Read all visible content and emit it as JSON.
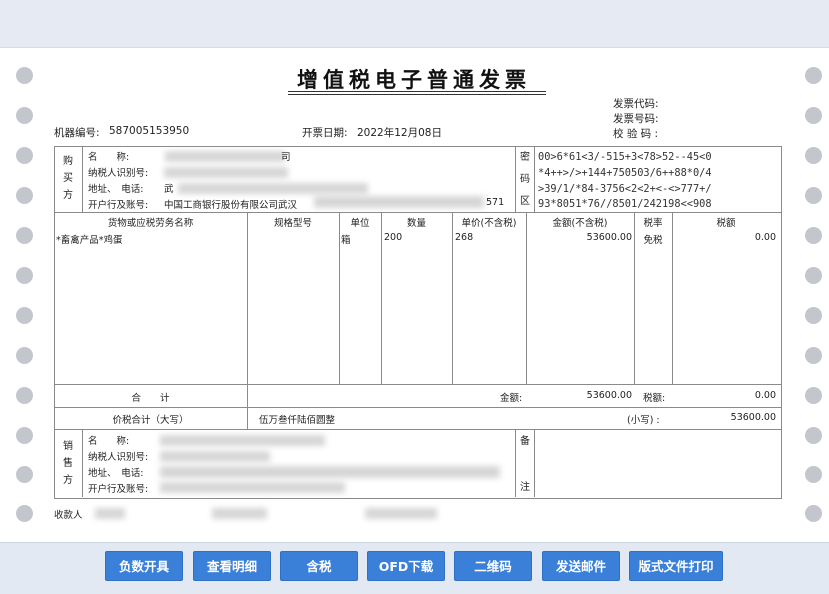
{
  "invoice": {
    "title": "增值税电子普通发票",
    "meta": {
      "code_label": "发票代码:",
      "number_label": "发票号码:",
      "check_label": "校 验 码 :",
      "machine_label": "机器编号:",
      "machine_no": "587005153950",
      "date_label": "开票日期:",
      "date": "2022年12月08日"
    },
    "buyer": {
      "section": [
        "购",
        "买",
        "方"
      ],
      "name_label": "名　　称:",
      "name_partial": "司",
      "taxid_label": "纳税人识别号:",
      "addr_label": "地址、　电话:",
      "addr_partial": "武",
      "bank_label": "开户行及账号:",
      "bank": "中国工商银行股份有限公司武汉",
      "bank_tail": "571"
    },
    "cipher": {
      "section": [
        "密",
        "码",
        "区"
      ],
      "lines": [
        "00>6*61<3/-515+3<78>52--45<0",
        "*4++>/>+144+750503/6++88*0/4",
        ">39/1/*84-3756<2<2+<-<>777+/",
        "93*8051*76//8501/242198<<908"
      ]
    },
    "items_header": {
      "name": "货物或应税劳务名称",
      "spec": "规格型号",
      "unit": "单位",
      "qty": "数量",
      "price": "单价(不含税)",
      "amount": "金额(不含税)",
      "rate": "税率",
      "tax": "税额"
    },
    "items": [
      {
        "name": "*畜禽产品*鸡蛋",
        "spec": "",
        "unit": "箱",
        "qty": "200",
        "price": "268",
        "amount": "53600.00",
        "rate": "免税",
        "tax": "0.00"
      }
    ],
    "totals": {
      "label": "合　　计",
      "amount_label": "金额:",
      "amount": "53600.00",
      "tax_label": "税额:",
      "tax": "0.00"
    },
    "grand_total": {
      "label": "价税合计（大写）",
      "upper": "伍万叁仟陆佰圆整",
      "lower_label": "(小写) :",
      "lower": "53600.00"
    },
    "seller": {
      "section": [
        "销",
        "售",
        "方"
      ],
      "name_label": "名　　称:",
      "taxid_label": "纳税人识别号:",
      "addr_label": "地址、　电话:",
      "bank_label": "开户行及账号:",
      "remark_section": [
        "备",
        "注"
      ]
    },
    "footer": {
      "payee_label": "收款人"
    }
  },
  "toolbar": {
    "buttons": [
      "负数开具",
      "查看明细",
      "含税",
      "OFD下载",
      "二维码",
      "发送邮件",
      "版式文件打印"
    ]
  },
  "colors": {
    "button_bg": "#3a7fd8",
    "hole": "#c3c7cd",
    "border": "#8a8a8a"
  }
}
